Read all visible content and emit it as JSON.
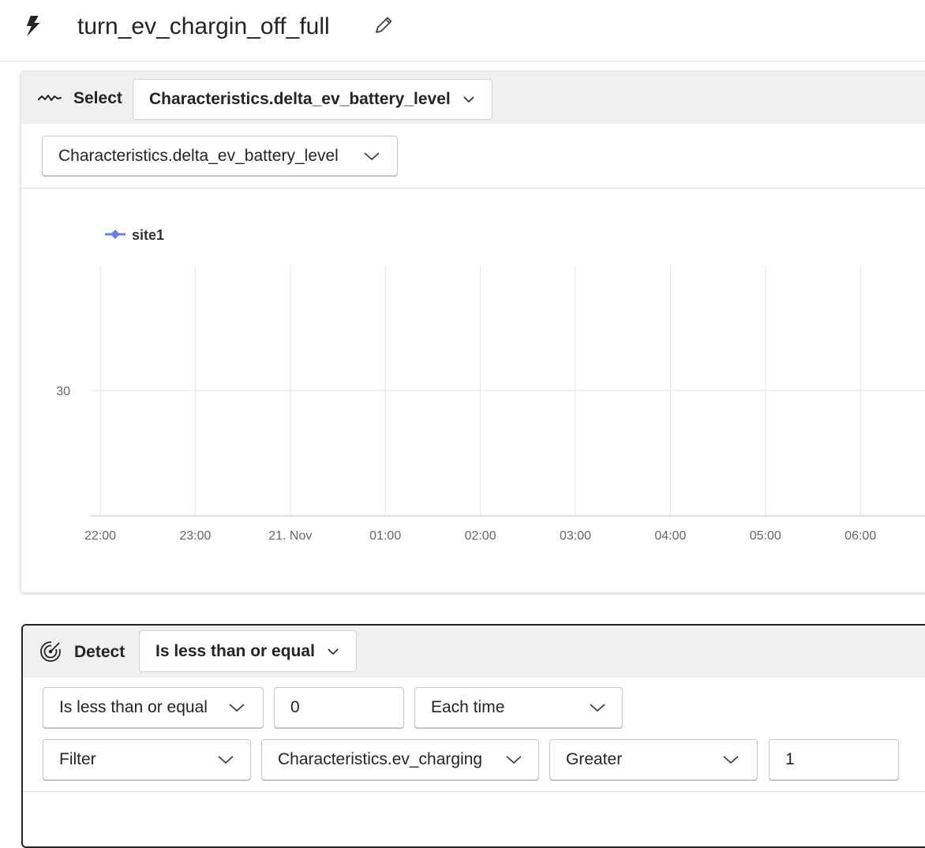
{
  "header": {
    "title": "turn_ev_chargin_off_full",
    "icon": "bolt-icon",
    "edit_icon": "pencil-icon"
  },
  "select_section": {
    "icon": "signal-wave-icon",
    "label": "Select",
    "header_dropdown": "Characteristics.delta_ev_battery_level",
    "property_dropdown": "Characteristics.delta_ev_battery_level"
  },
  "chart_data": {
    "type": "line",
    "legend_position": "top-left",
    "grid": true,
    "series": [
      {
        "name": "site1",
        "color": "#6b7fe0",
        "values": []
      }
    ],
    "x_tick_labels": [
      "22:00",
      "23:00",
      "21. Nov",
      "01:00",
      "02:00",
      "03:00",
      "04:00",
      "05:00",
      "06:00"
    ],
    "y_tick_labels": [
      "30"
    ]
  },
  "detect_section": {
    "icon": "radar-icon",
    "label": "Detect",
    "header_dropdown": "Is less than or equal",
    "condition_dropdown": "Is less than or equal",
    "threshold_value": "0",
    "frequency_dropdown": "Each time",
    "filter_dropdown": "Filter",
    "filter_property_dropdown": "Characteristics.ev_charging",
    "filter_operator_dropdown": "Greater",
    "filter_value": "1"
  }
}
